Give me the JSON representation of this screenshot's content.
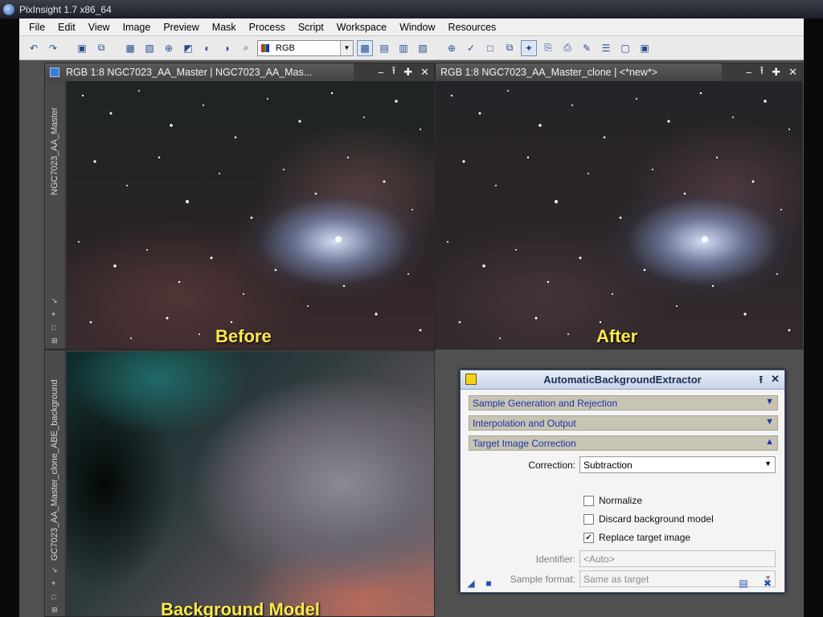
{
  "app": {
    "title": "PixInsight 1.7 x86_64"
  },
  "menu": [
    "File",
    "Edit",
    "View",
    "Image",
    "Preview",
    "Mask",
    "Process",
    "Script",
    "Workspace",
    "Window",
    "Resources"
  ],
  "toolbar": {
    "colorspace_select": "RGB"
  },
  "windows": {
    "before": {
      "title": "RGB 1:8 NGC7023_AA_Master | NGC7023_AA_Mas...",
      "side_label": "NGC7023_AA_Master",
      "caption": "Before"
    },
    "after": {
      "title": "RGB 1:8 NGC7023_AA_Master_clone | <*new*>",
      "caption": "After"
    },
    "background": {
      "side_label": "GC7023_AA_Master_clone_ABE_background",
      "caption": "Background Model"
    }
  },
  "dialog": {
    "title": "AutomaticBackgroundExtractor",
    "sections": [
      {
        "label": "Sample Generation and Rejection",
        "state": "collapsed"
      },
      {
        "label": "Interpolation and Output",
        "state": "collapsed"
      },
      {
        "label": "Target Image Correction",
        "state": "expanded"
      }
    ],
    "correction_label": "Correction:",
    "correction_value": "Subtraction",
    "normalize_label": "Normalize",
    "normalize_checked": false,
    "discard_label": "Discard background model",
    "discard_checked": false,
    "replace_label": "Replace target image",
    "replace_checked": true,
    "identifier_label": "Identifier:",
    "identifier_placeholder": "<Auto>",
    "sample_format_label": "Sample format:",
    "sample_format_value": "Same as target"
  },
  "colors": {
    "caption": "#ffe94d",
    "dialog_section_bg": "#c8c4b4",
    "dialog_link": "#1b35a8"
  }
}
